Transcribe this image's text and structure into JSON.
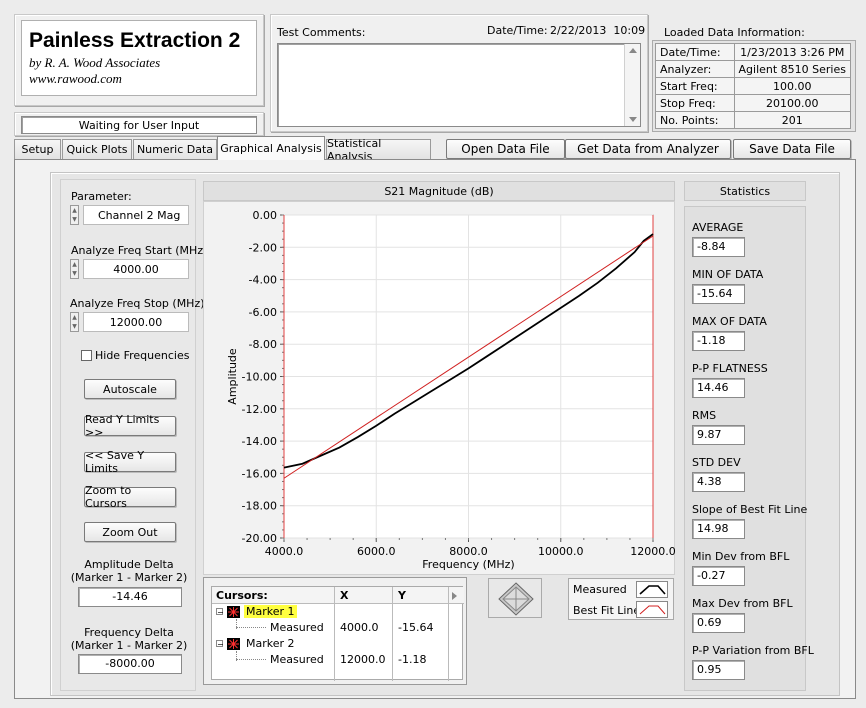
{
  "app": {
    "title": "Painless Extraction 2",
    "byline": "by R. A. Wood Associates",
    "url": "www.rawood.com",
    "status": "Waiting for User Input"
  },
  "comments": {
    "label": "Test Comments:"
  },
  "datetime": {
    "label": "Date/Time:",
    "value": "2/22/2013  10:09"
  },
  "loaded": {
    "title": "Loaded Data Information:",
    "rows": [
      {
        "k": "Date/Time:",
        "v": "1/23/2013 3:26 PM"
      },
      {
        "k": "Analyzer:",
        "v": "Agilent 8510 Series"
      },
      {
        "k": "Start Freq:",
        "v": "100.00"
      },
      {
        "k": "Stop Freq:",
        "v": "20100.00"
      },
      {
        "k": "No. Points:",
        "v": "201"
      }
    ]
  },
  "tabs": [
    "Setup",
    "Quick Plots",
    "Numeric Data",
    "Graphical Analysis",
    "Statistical Analysis"
  ],
  "actions": {
    "open": "Open Data File",
    "get": "Get Data from Analyzer",
    "save": "Save Data File"
  },
  "left": {
    "param_label": "Parameter:",
    "param_value": "Channel 2 Mag",
    "start_label": "Analyze Freq Start (MHz)",
    "start_value": "4000.00",
    "stop_label": "Analyze Freq Stop (MHz)",
    "stop_value": "12000.00",
    "hide_freq": "Hide Frequencies",
    "btn_autoscale": "Autoscale",
    "btn_read_y": "Read Y Limits >>",
    "btn_save_y": "<< Save Y Limits",
    "btn_zoom_cursors": "Zoom to Cursors",
    "btn_zoom_out": "Zoom Out",
    "amp_delta_label_1": "Amplitude Delta",
    "amp_delta_label_2": "(Marker 1 - Marker 2)",
    "amp_delta_value": "-14.46",
    "freq_delta_label_1": "Frequency Delta",
    "freq_delta_label_2": "(Marker 1 - Marker 2)",
    "freq_delta_value": "-8000.00"
  },
  "legend": {
    "measured": "Measured",
    "bestfit": "Best Fit Line"
  },
  "cursors": {
    "headers": [
      "Cursors:",
      "X",
      "Y"
    ],
    "rows": [
      {
        "name": "Marker 1",
        "sub": "Measured",
        "x": "4000.0",
        "y": "-15.64"
      },
      {
        "name": "Marker 2",
        "sub": "Measured",
        "x": "12000.0",
        "y": "-1.18"
      }
    ]
  },
  "stats": {
    "title": "Statistics",
    "items": [
      {
        "label": "AVERAGE",
        "value": "-8.84"
      },
      {
        "label": "MIN OF DATA",
        "value": "-15.64"
      },
      {
        "label": "MAX OF DATA",
        "value": "-1.18"
      },
      {
        "label": "P-P FLATNESS",
        "value": "14.46"
      },
      {
        "label": "RMS",
        "value": "9.87"
      },
      {
        "label": "STD DEV",
        "value": "4.38"
      },
      {
        "label": "Slope of Best Fit Line",
        "value": "14.98"
      },
      {
        "label": "Min Dev from BFL",
        "value": "-0.27"
      },
      {
        "label": "Max Dev from BFL",
        "value": "0.69"
      },
      {
        "label": "P-P Variation from BFL",
        "value": "0.95"
      }
    ]
  },
  "chart_data": {
    "type": "line",
    "title": "S21 Magnitude (dB)",
    "xlabel": "Frequency (MHz)",
    "ylabel": "Amplitude",
    "xlim": [
      4000,
      12000
    ],
    "ylim": [
      -20,
      0
    ],
    "xticks": [
      "4000.0",
      "6000.0",
      "8000.0",
      "10000.0",
      "12000.0"
    ],
    "yticks": [
      "0.00",
      "-2.00",
      "-4.00",
      "-6.00",
      "-8.00",
      "-10.00",
      "-12.00",
      "-14.00",
      "-16.00",
      "-18.00",
      "-20.00"
    ],
    "grid": true,
    "colors": {
      "measured": "#000000",
      "bestfit": "#d02020"
    },
    "series": [
      {
        "name": "Measured",
        "x": [
          4000,
          4400,
          4800,
          5200,
          5600,
          6000,
          6400,
          6800,
          7200,
          7600,
          8000,
          8400,
          8800,
          9200,
          9600,
          10000,
          10400,
          10800,
          11200,
          11600,
          11800,
          12000
        ],
        "y": [
          -15.64,
          -15.4,
          -14.9,
          -14.4,
          -13.75,
          -13.05,
          -12.3,
          -11.6,
          -10.9,
          -10.2,
          -9.5,
          -8.75,
          -8.0,
          -7.25,
          -6.5,
          -5.75,
          -5.0,
          -4.2,
          -3.3,
          -2.3,
          -1.6,
          -1.18
        ]
      },
      {
        "name": "Best Fit Line",
        "x": [
          4000,
          12000
        ],
        "y": [
          -16.3,
          -1.3
        ]
      }
    ]
  }
}
